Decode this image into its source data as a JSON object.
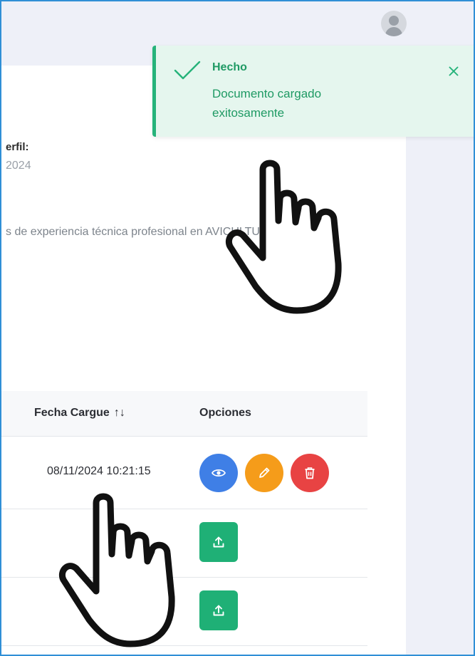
{
  "profile": {
    "label": "erfil:",
    "date": "2024",
    "description": "s de experiencia técnica profesional en AVICULTURA y"
  },
  "table": {
    "headers": {
      "date": "Fecha Cargue",
      "sort_icon": "↑↓",
      "options": "Opciones"
    },
    "rows": [
      {
        "date": "08/11/2024 10:21:15",
        "actions": [
          "view",
          "edit",
          "delete"
        ]
      },
      {
        "date": "-",
        "actions": [
          "upload"
        ]
      },
      {
        "date": "-",
        "actions": [
          "upload"
        ]
      }
    ]
  },
  "toast": {
    "title": "Hecho",
    "message": "Documento cargado exitosamente",
    "icon": "check-icon",
    "close_icon": "close-icon",
    "accent": "#26b37a",
    "background": "#e5f6ee"
  },
  "icons": {
    "view": "eye-icon",
    "edit": "pencil-icon",
    "delete": "trash-icon",
    "upload": "upload-icon",
    "avatar": "user-avatar-icon",
    "pointer": "pointing-hand-icon"
  },
  "colors": {
    "view": "#3f7fe6",
    "edit": "#f59c1a",
    "delete": "#e84343",
    "upload": "#1fb076"
  }
}
